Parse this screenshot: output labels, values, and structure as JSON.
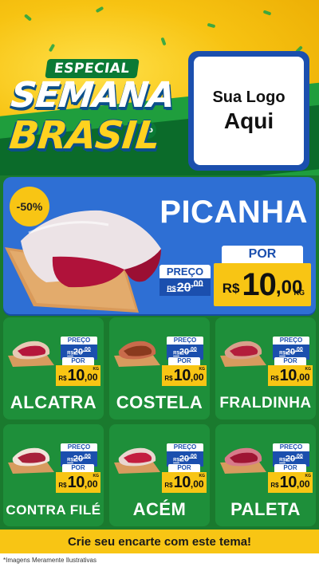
{
  "header": {
    "especial": "ESPECIAL",
    "semana": "SEMANA",
    "do": "do",
    "brasil": "BRASIL",
    "logo_line1": "Sua Logo",
    "logo_line2": "Aqui"
  },
  "hero": {
    "discount": "-50%",
    "product": "PICANHA",
    "old_label": "PREÇO",
    "old_currency": "R$",
    "old_int": "20",
    "old_cents": ",00",
    "new_label": "POR",
    "new_currency": "R$",
    "new_int": "10",
    "new_cents": ",00",
    "unit": "KG"
  },
  "products": [
    {
      "name": "ALCATRA",
      "old_label": "PREÇO",
      "old_currency": "R$",
      "old_int": "20",
      "old_cents": ",00",
      "new_label": "POR",
      "new_currency": "R$",
      "new_int": "10",
      "new_cents": ",00",
      "unit": "KG"
    },
    {
      "name": "COSTELA",
      "old_label": "PREÇO",
      "old_currency": "R$",
      "old_int": "20",
      "old_cents": ",00",
      "new_label": "POR",
      "new_currency": "R$",
      "new_int": "10",
      "new_cents": ",00",
      "unit": "KG"
    },
    {
      "name": "FRALDINHA",
      "old_label": "PREÇO",
      "old_currency": "R$",
      "old_int": "20",
      "old_cents": ",00",
      "new_label": "POR",
      "new_currency": "R$",
      "new_int": "10",
      "new_cents": ",00",
      "unit": "KG"
    },
    {
      "name": "CONTRA FILÉ",
      "old_label": "PREÇO",
      "old_currency": "R$",
      "old_int": "20",
      "old_cents": ",00",
      "new_label": "POR",
      "new_currency": "R$",
      "new_int": "10",
      "new_cents": ",00",
      "unit": "KG"
    },
    {
      "name": "ACÉM",
      "old_label": "PREÇO",
      "old_currency": "R$",
      "old_int": "20",
      "old_cents": ",00",
      "new_label": "POR",
      "new_currency": "R$",
      "new_int": "10",
      "new_cents": ",00",
      "unit": "KG"
    },
    {
      "name": "PALETA",
      "old_label": "PREÇO",
      "old_currency": "R$",
      "old_int": "20",
      "old_cents": ",00",
      "new_label": "POR",
      "new_currency": "R$",
      "new_int": "10",
      "new_cents": ",00",
      "unit": "KG"
    }
  ],
  "footer": {
    "cta": "Crie seu encarte com este tema!",
    "disclaimer": "*Imagens Meramente Ilustrativas"
  },
  "colors": {
    "yellow": "#f8c514",
    "green": "#1e8f3a",
    "blue": "#2e6fd4",
    "dark_blue": "#1b4fae"
  }
}
